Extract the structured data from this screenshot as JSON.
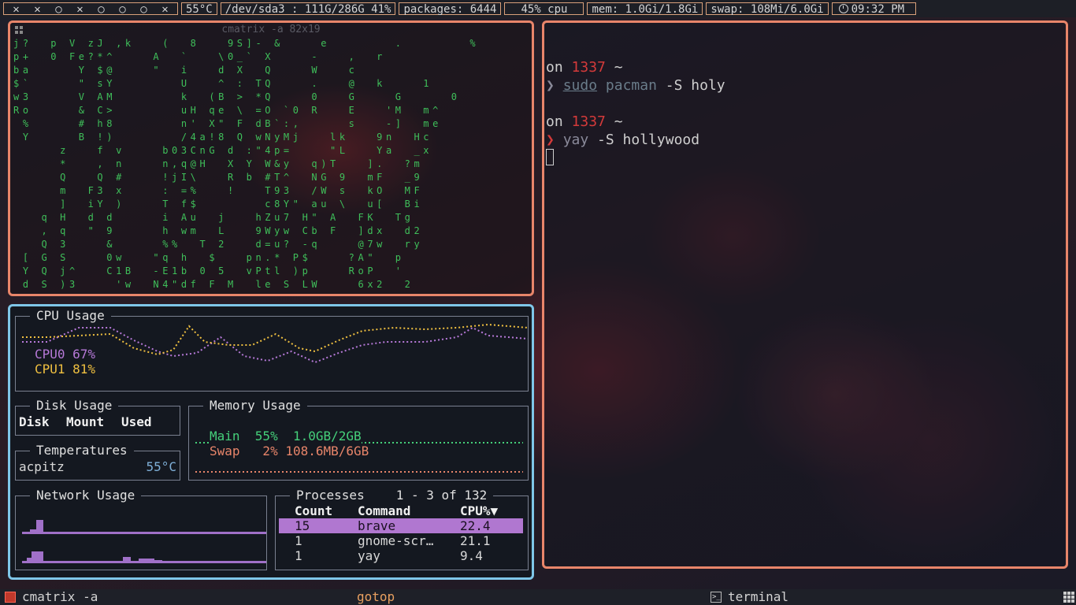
{
  "topbar": {
    "workspaces": [
      "✕",
      "✕",
      "○",
      "✕",
      "○",
      "○",
      "○",
      "✕"
    ],
    "temperature": "55°C",
    "disk": "/dev/sda3 : 111G/286G 41%",
    "packages": "packages: 6444",
    "cpu": "45% cpu",
    "mem": "mem: 1.0Gi/1.8Gi",
    "swap": "swap: 108Mi/6.0Gi",
    "clock": "09:32 PM"
  },
  "matrix_window": {
    "title": "cmatrix -a 82x19",
    "rows": [
      "j?  p V zJ ,k   (  8   9S]- &    e       .       %",
      "p+  0 Fe?*^    A  `   \\0_` X    -   ,  r",
      "ba     Y $@    \"  i   d X  Q    W   c",
      "$`     \" sY       U   ^ : TQ    .   @  k    1",
      "w3     V AM       k  (B > *Q    0   G    G     0",
      "Ro     & C>       uH qe \\ =O `0 R   E   'M  m^",
      " %     # h8       n' X\" F dB`:,     s   -]  me",
      " Y     B !)       /4a!8 Q wNyMj   lk   9n  Hc",
      "     z   f v    b03CnG d :\"4p=    \"L   Ya  _x",
      "     *   , n    n,q@H  X Y W&y  q)T   ].  ?m",
      "     Q   Q #    !jI\\   R b #T^  NG 9  mF  _9",
      "     m  F3 x    : =%   !   T93  /W s  kO  MF",
      "     ]  iY )    T f$       c8Y\" au \\  u[  Bi",
      "   q H  d d     i Au  j   hZu7 H\" A  FK  Tg",
      "   , q  \" 9     h wm  L   9Wyw Cb F  ]dx  d2",
      "   Q 3    &     %%  T 2   d=u? -q    @7w  ry",
      " [ G S    0w   \"q h  $   pn.* P$    ?A\"  p",
      " Y Q j^   C1B  -E1b 0 5  vPtl )p    RoP  '",
      " d S )3    'w  N4\"df F M  le S LW    6x2  2"
    ]
  },
  "terminal": {
    "prompt1_prefix": "on ",
    "prompt1_host": "1337",
    "prompt1_suffix": " ~",
    "cmd1_arrow": "❯ ",
    "cmd1_sudo": "sudo",
    "cmd1_pacman": "pacman",
    "cmd1_rest": " -S holy",
    "prompt2_prefix": "on ",
    "prompt2_host": "1337",
    "prompt2_suffix": " ~",
    "cmd2_arrow": "❯ ",
    "cmd2_yay": "yay",
    "cmd2_rest": " -S hollywood"
  },
  "gotop": {
    "cpu_title": "CPU Usage",
    "cpu0_label": "CPU0 67%",
    "cpu1_label": "CPU1 81%",
    "disk_title": "Disk Usage",
    "disk_headers": [
      "Disk",
      "Mount",
      "Used"
    ],
    "temp_title": "Temperatures",
    "temp_sensor": "acpitz",
    "temp_value": "55°C",
    "memory_title": "Memory Usage",
    "mem_main": "Main  55%  1.0GB/2GB",
    "mem_swap": "Swap   2% 108.6MB/6GB",
    "network_title": "Network Usage",
    "processes_title": "Processes",
    "processes_range": "1 - 3 of 132",
    "proc_headers": [
      "Count",
      "Command",
      "CPU%▼"
    ],
    "processes": [
      {
        "count": "15",
        "command": "brave",
        "cpu": "22.4"
      },
      {
        "count": "1",
        "command": "gnome-scr…",
        "cpu": "21.1"
      },
      {
        "count": "1",
        "command": "yay",
        "cpu": "9.4"
      }
    ]
  },
  "bottombar": {
    "left_title": "cmatrix -a",
    "center_title": "gotop",
    "right_title": "terminal"
  },
  "colors": {
    "window_border": "#e8856a",
    "gotop_border": "#7fc6e8",
    "cpu0": "#b679d8",
    "cpu1": "#f0c040",
    "mem_main": "#45d07a",
    "mem_swap": "#e8856a",
    "net": "#a070c8",
    "proc_highlight": "#b077d0",
    "matrix_green": "#3fbf5a",
    "host_red": "#d33a3a"
  }
}
